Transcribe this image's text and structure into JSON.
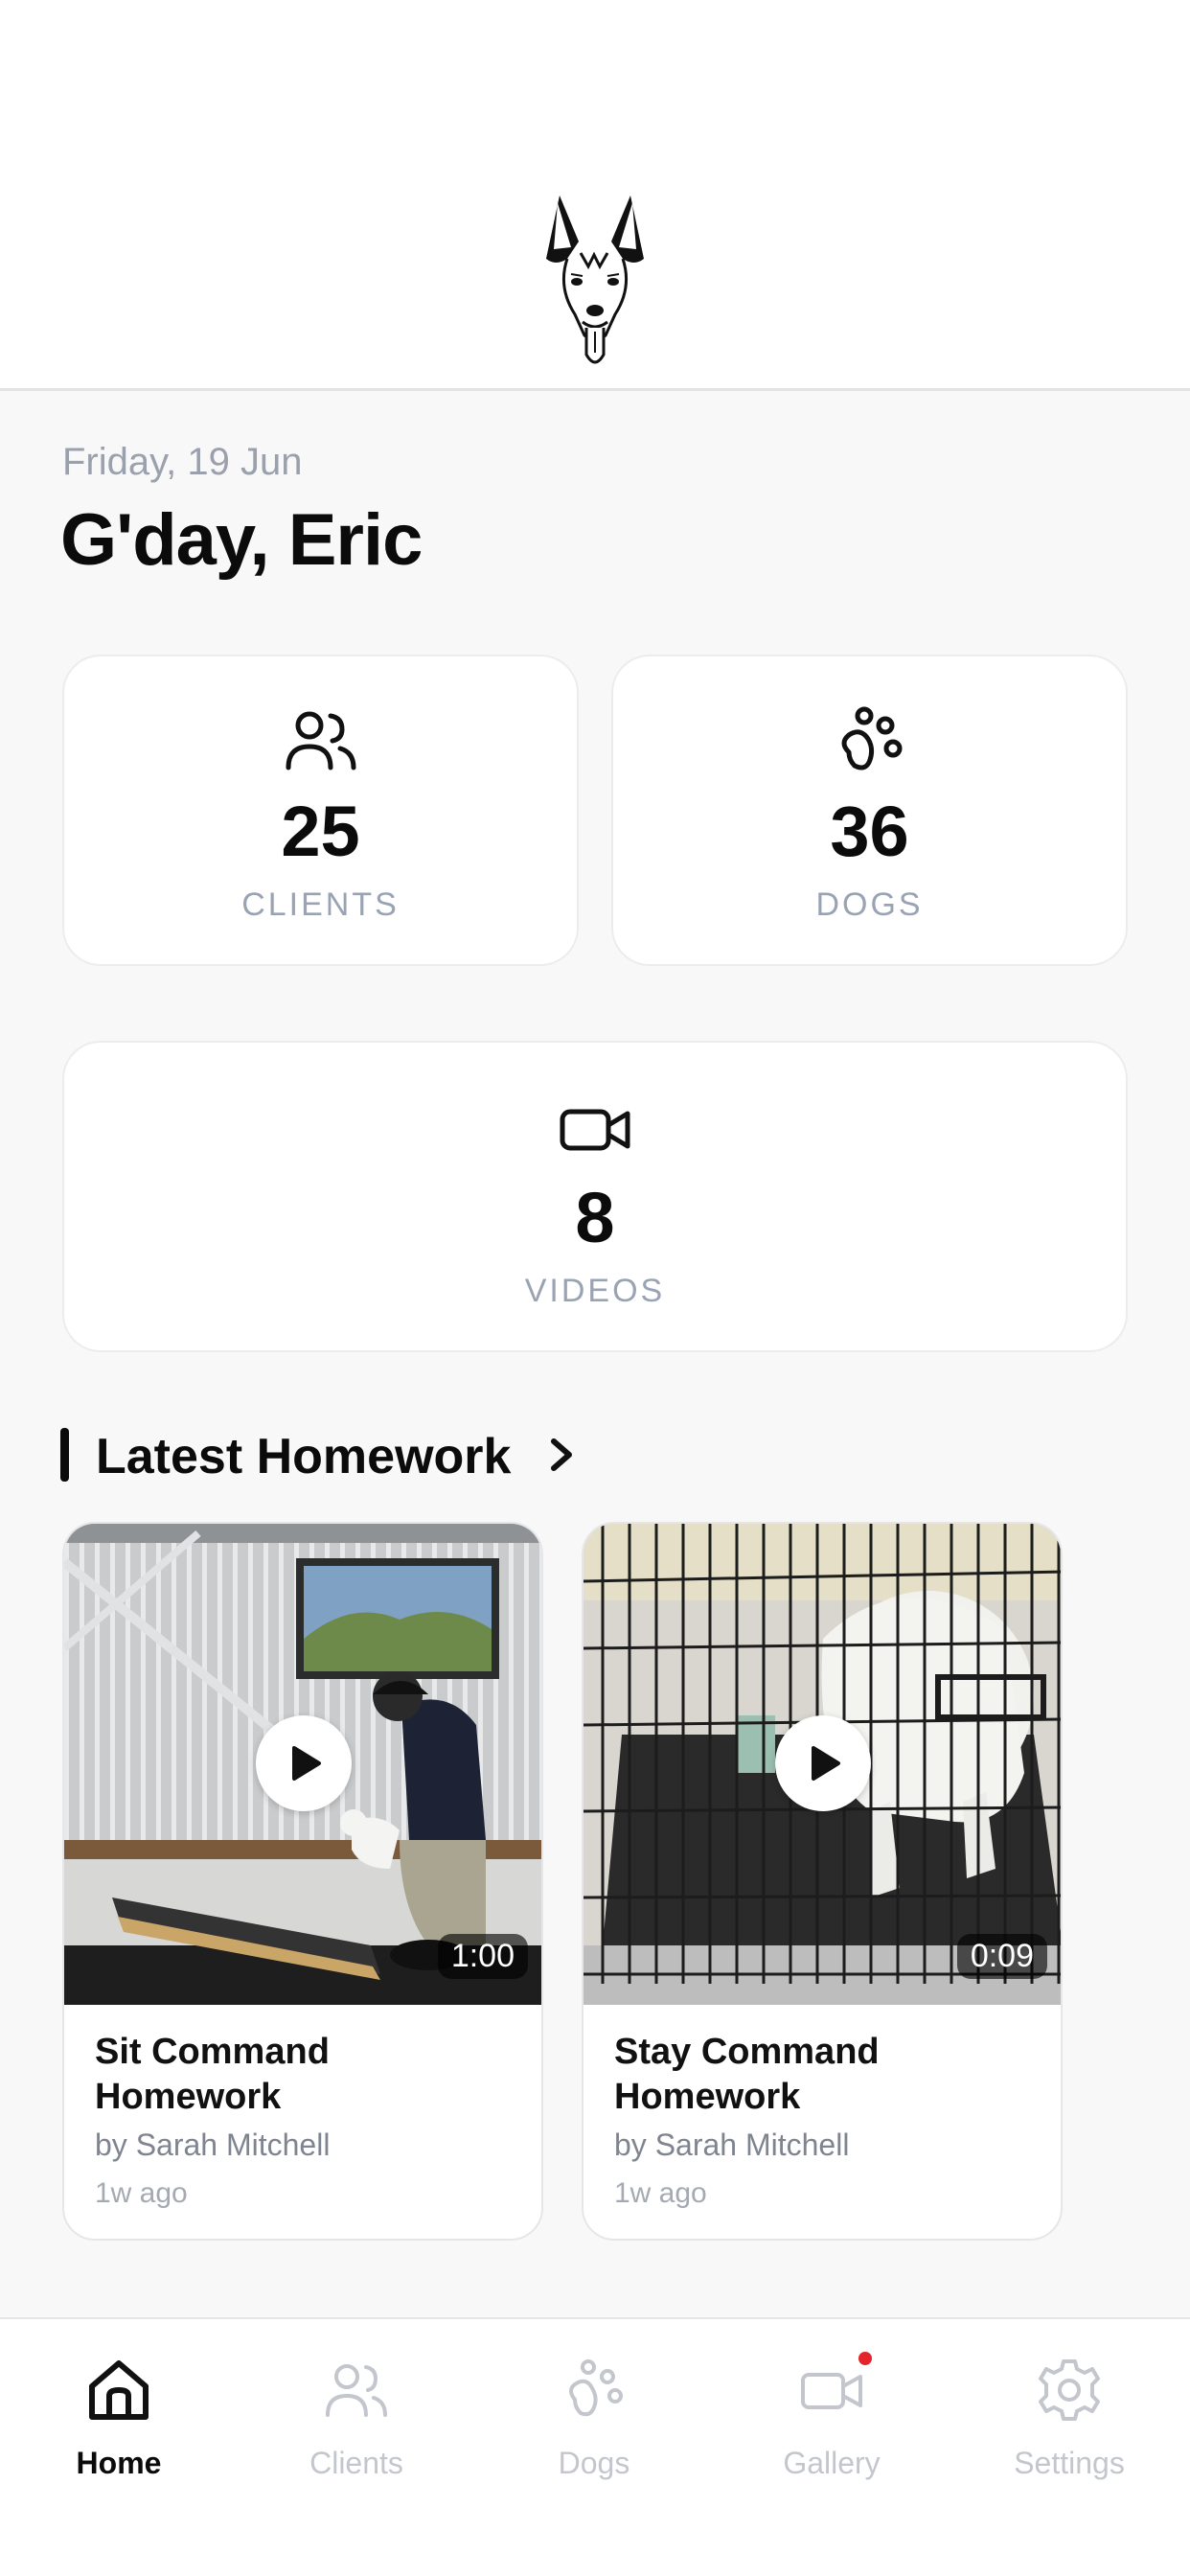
{
  "header": {
    "logo_icon": "dog-head-logo"
  },
  "greeting": {
    "date": "Friday, 19 Jun",
    "title": "G'day, Eric"
  },
  "stats": {
    "clients": {
      "value": "25",
      "label": "CLIENTS",
      "icon": "users-icon"
    },
    "dogs": {
      "value": "36",
      "label": "DOGS",
      "icon": "paw-icon"
    },
    "videos": {
      "value": "8",
      "label": "VIDEOS",
      "icon": "video-icon"
    }
  },
  "section": {
    "title": "Latest Homework"
  },
  "homework": [
    {
      "title": "Sit Command Homework",
      "author": "by Sarah Mitchell",
      "time": "1w ago",
      "duration": "1:00"
    },
    {
      "title": "Stay Command Homework",
      "author": "by Sarah Mitchell",
      "time": "1w ago",
      "duration": "0:09"
    }
  ],
  "tabbar": {
    "tabs": [
      {
        "label": "Home",
        "icon": "home-icon",
        "active": true
      },
      {
        "label": "Clients",
        "icon": "users-icon",
        "active": false
      },
      {
        "label": "Dogs",
        "icon": "paw-icon",
        "active": false
      },
      {
        "label": "Gallery",
        "icon": "video-icon",
        "active": false,
        "badge": true
      },
      {
        "label": "Settings",
        "icon": "gear-icon",
        "active": false
      }
    ]
  },
  "colors": {
    "accent": "#0b0b0b",
    "muted": "#9aa3b3",
    "badge": "#e3242b",
    "background": "#f8f8f9"
  }
}
